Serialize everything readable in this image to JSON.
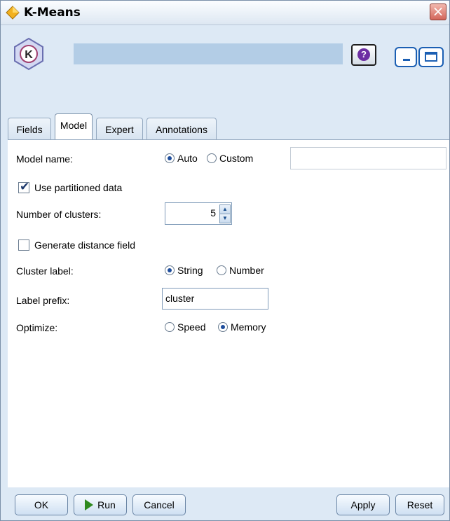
{
  "window": {
    "title": "K-Means"
  },
  "tabs": [
    {
      "label": "Fields"
    },
    {
      "label": "Model"
    },
    {
      "label": "Expert"
    },
    {
      "label": "Annotations"
    }
  ],
  "model": {
    "model_name": {
      "label": "Model name:",
      "options": [
        "Auto",
        "Custom"
      ],
      "selected": "Auto",
      "custom_value": ""
    },
    "use_partitioned": {
      "label": "Use partitioned data",
      "checked": true
    },
    "num_clusters": {
      "label": "Number of clusters:",
      "value": "5"
    },
    "distance_field": {
      "label": "Generate distance field",
      "checked": false
    },
    "cluster_label": {
      "label": "Cluster label:",
      "options": [
        "String",
        "Number"
      ],
      "selected": "String"
    },
    "label_prefix": {
      "label": "Label prefix:",
      "value": "cluster"
    },
    "optimize": {
      "label": "Optimize:",
      "options": [
        "Speed",
        "Memory"
      ],
      "selected": "Memory"
    }
  },
  "buttons": {
    "ok": "OK",
    "run": "Run",
    "cancel": "Cancel",
    "apply": "Apply",
    "reset": "Reset"
  },
  "icons": [
    "kmeans-diamond-icon",
    "kmeans-node-icon",
    "help-icon",
    "minimize-icon",
    "maximize-icon",
    "close-icon",
    "run-play-icon",
    "spinner-up-icon",
    "spinner-down-icon"
  ],
  "colors": {
    "window_bg": "#dde9f5",
    "banner": "#b3cde6",
    "close": "#d3665a",
    "help": "#6d2fa3",
    "run_arrow": "#2f8a1f"
  }
}
